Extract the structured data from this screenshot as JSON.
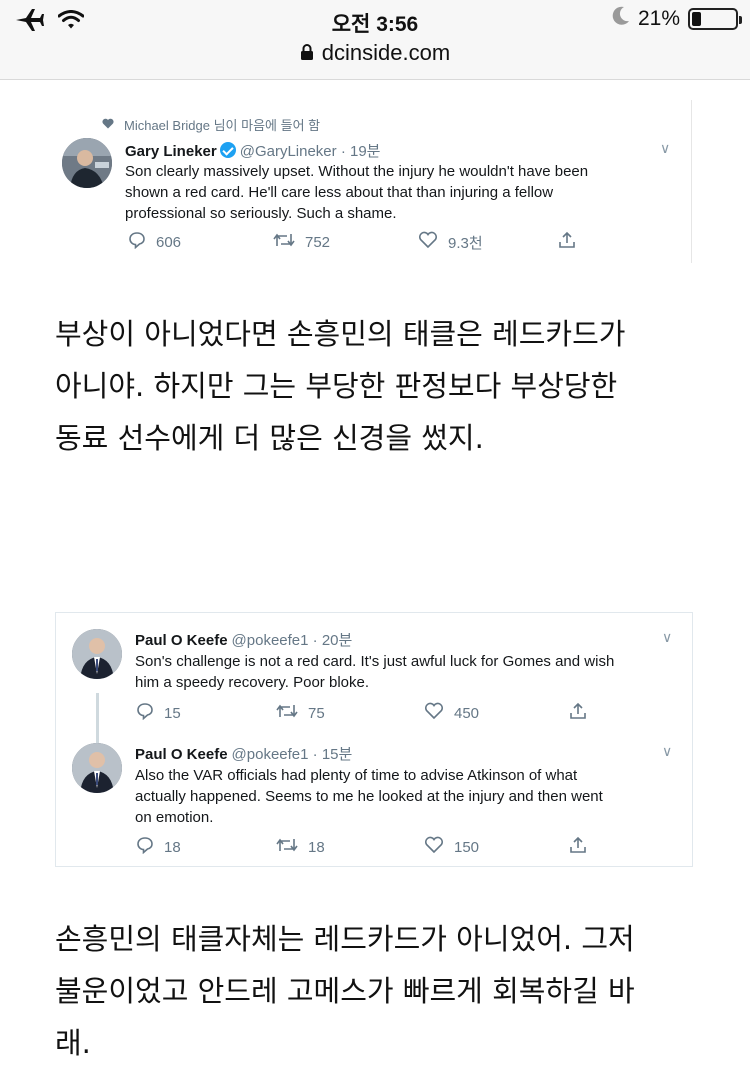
{
  "status_bar": {
    "time": "오전 3:56",
    "battery_percent": "21%",
    "battery_level": 0.21,
    "icons": [
      "airplane-icon",
      "wifi-icon",
      "moon-icon",
      "battery-icon"
    ]
  },
  "url_bar": {
    "domain": "dcinside.com"
  },
  "tweet1": {
    "liked_by": "Michael Bridge 님이 마음에 들어 함",
    "name": "Gary Lineker",
    "handle_time": "@GaryLineker · 19분",
    "verified": true,
    "text_lines": [
      "Son clearly massively upset. Without the injury he wouldn't have been",
      "shown a red card. He'll care less about that than injuring a fellow",
      "professional so seriously. Such a shame."
    ],
    "replies": "606",
    "retweets": "752",
    "likes": "9.3천"
  },
  "caption1_lines": [
    "부상이 아니었다면 손흥민의 태클은 레드카드가",
    "아니야. 하지만 그는 부당한 판정보다 부상당한",
    "동료 선수에게 더 많은 신경을 썼지."
  ],
  "tweet2": {
    "name": "Paul O Keefe",
    "handle_time": "@pokeefe1 · 20분",
    "text_lines": [
      "Son's challenge is not a red card. It's just awful luck for Gomes and wish",
      "him a speedy recovery. Poor bloke."
    ],
    "replies": "15",
    "retweets": "75",
    "likes": "450"
  },
  "tweet3": {
    "name": "Paul O Keefe",
    "handle_time": "@pokeefe1 · 15분",
    "text_lines": [
      "Also the VAR officials had plenty of time to advise Atkinson of what",
      "actually happened. Seems to me he looked at the injury and then went",
      "on emotion."
    ],
    "replies": "18",
    "retweets": "18",
    "likes": "150"
  },
  "caption2_lines": [
    "손흥민의 태클자체는 레드카드가 아니었어. 그저",
    "불운이었고 안드레 고메스가 빠르게 회복하길 바",
    "래."
  ],
  "colors": {
    "verified": "#1da1f2",
    "muted": "#657786"
  }
}
